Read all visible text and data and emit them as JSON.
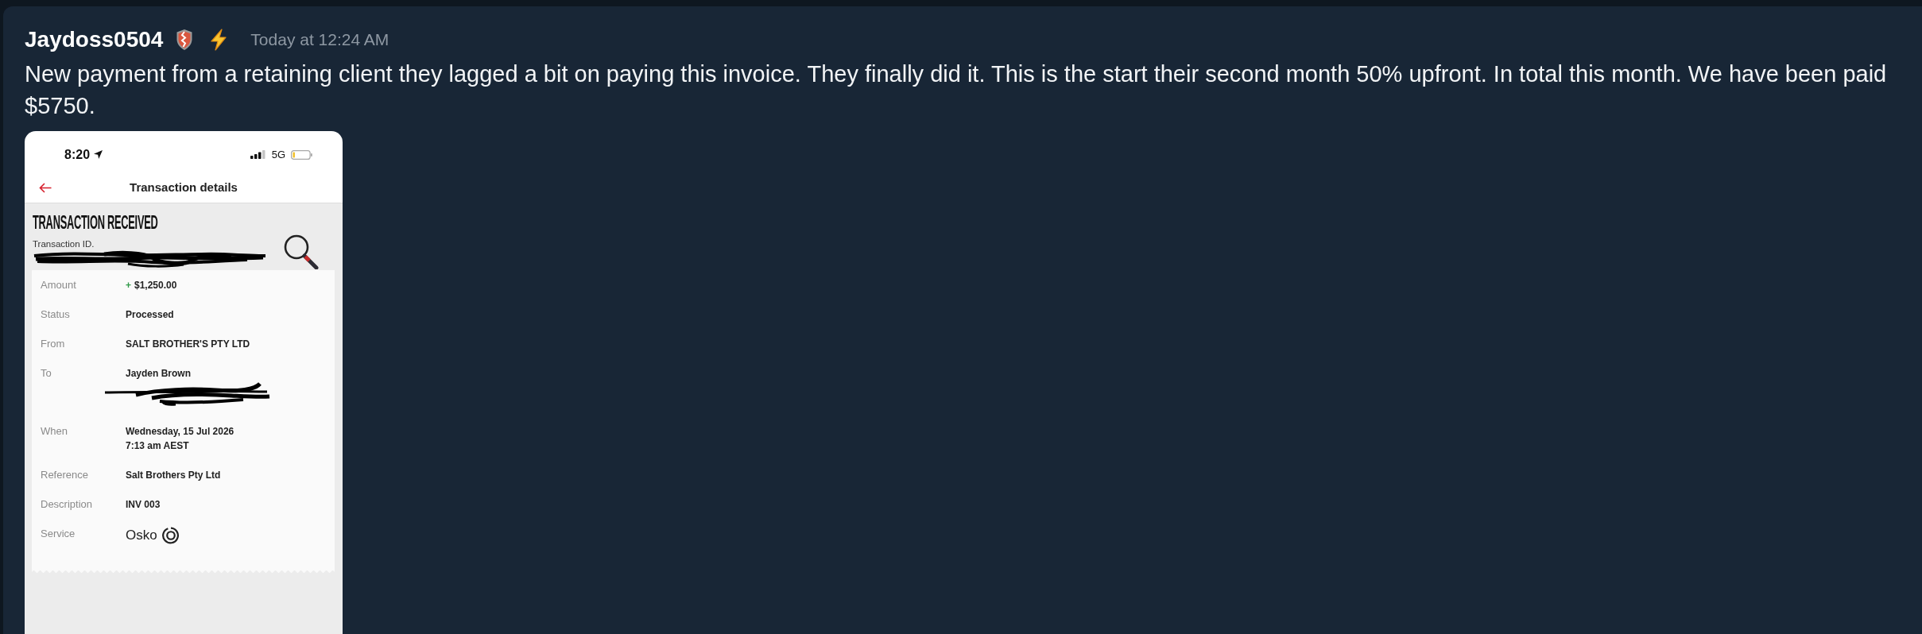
{
  "message": {
    "author": "Jaydoss0504",
    "timestamp": "Today at 12:24 AM",
    "text": "New payment from a retaining client they lagged a bit on paying this invoice. They finally did it. This is the start their second month 50% upfront. In total this month. We have been paid $5750."
  },
  "attachment": {
    "status_bar": {
      "time": "8:20",
      "network": "5G"
    },
    "nav": {
      "title": "Transaction details"
    },
    "heading": "TRANSACTION RECEIVED",
    "transaction_id": {
      "label": "Transaction ID.",
      "redacted": true
    },
    "rows": [
      {
        "kind": "amount",
        "label": "Amount",
        "sign": "+",
        "lines": [
          "$1,250.00"
        ],
        "redacted": false
      },
      {
        "kind": "plain",
        "label": "Status",
        "lines": [
          "Processed"
        ],
        "redacted": false
      },
      {
        "kind": "plain",
        "label": "From",
        "lines": [
          "SALT BROTHER'S PTY LTD"
        ],
        "redacted": false
      },
      {
        "kind": "plain",
        "label": "To",
        "lines": [
          "Jayden Brown"
        ],
        "redacted": true
      },
      {
        "kind": "plain",
        "label": "When",
        "lines": [
          "Wednesday, 15 Jul 2026",
          "7:13 am AEST"
        ],
        "redacted": false
      },
      {
        "kind": "plain",
        "label": "Reference",
        "lines": [
          "Salt Brothers Pty Ltd"
        ],
        "redacted": false
      },
      {
        "kind": "plain",
        "label": "Description",
        "lines": [
          "INV 003"
        ],
        "redacted": false
      },
      {
        "kind": "service",
        "label": "Service",
        "lines": [
          "Osko"
        ],
        "redacted": false
      }
    ]
  }
}
